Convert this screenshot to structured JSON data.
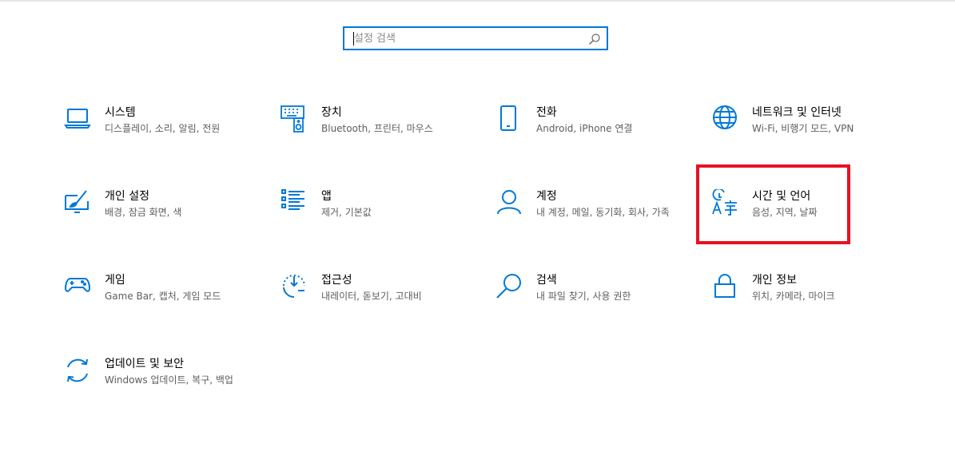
{
  "search": {
    "placeholder": "설정 검색",
    "value": ""
  },
  "accent_color": "#0078d7",
  "highlight_color": "#e81123",
  "tiles": [
    {
      "title": "시스템",
      "desc": "디스플레이, 소리, 알림, 전원",
      "icon": "laptop-icon"
    },
    {
      "title": "장치",
      "desc": "Bluetooth, 프린터, 마우스",
      "icon": "devices-icon"
    },
    {
      "title": "전화",
      "desc": "Android, iPhone 연결",
      "icon": "phone-icon"
    },
    {
      "title": "네트워크 및 인터넷",
      "desc": "Wi-Fi, 비행기 모드, VPN",
      "icon": "globe-icon"
    },
    {
      "title": "개인 설정",
      "desc": "배경, 잠금 화면, 색",
      "icon": "paint-icon"
    },
    {
      "title": "앱",
      "desc": "제거, 기본값",
      "icon": "apps-list-icon"
    },
    {
      "title": "계정",
      "desc": "내 계정, 메일, 동기화, 회사, 가족",
      "icon": "person-icon"
    },
    {
      "title": "시간 및 언어",
      "desc": "음성, 지역, 날짜",
      "icon": "time-language-icon"
    },
    {
      "title": "게임",
      "desc": "Game Bar, 캡처, 게임 모드",
      "icon": "gamepad-icon"
    },
    {
      "title": "접근성",
      "desc": "내레이터, 돋보기, 고대비",
      "icon": "ease-of-access-icon"
    },
    {
      "title": "검색",
      "desc": "내 파일 찾기, 사용 권한",
      "icon": "search-icon"
    },
    {
      "title": "개인 정보",
      "desc": "위치, 카메라, 마이크",
      "icon": "lock-icon"
    },
    {
      "title": "업데이트 및 보안",
      "desc": "Windows 업데이트, 복구, 백업",
      "icon": "update-icon"
    }
  ]
}
